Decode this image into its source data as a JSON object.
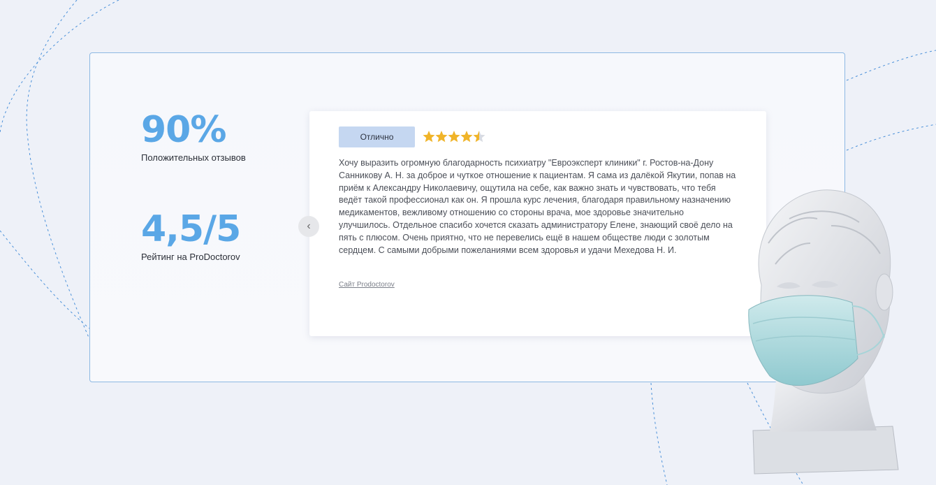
{
  "stats": [
    {
      "value": "90%",
      "label": "Положительных отзывов"
    },
    {
      "value": "4,5/5",
      "label": "Рейтинг на ProDoctorov"
    }
  ],
  "carousel": {
    "prev_icon": "‹"
  },
  "review": {
    "badge": "Отлично",
    "rating": 4.5,
    "rating_max": 5,
    "text": "Хочу выразить огромную благодарность психиатру \"Евроэксперт клиники\" г. Ростов-на-Дону Санникову А. Н. за доброе и чуткое отношение к пациентам. Я сама из далёкой Якутии, попав на приём к Александру Николаевичу, ощутила на себе, как важно знать и чувствовать, что тебя ведёт такой профессионал как он. Я прошла курс лечения, благодаря правильному назначению медикаментов, вежливому отношению со стороны врача, мое здоровье значительно улучшилось. Отдельное спасибо хочется сказать администратору Елене, знающий своё дело на пять с плюсом. Очень приятно, что не перевелись ещё в нашем обществе люди с золотым сердцем. С самыми добрыми пожеланиями всем здоровья и удачи Мехедова Н. И.",
    "source": "Сайт Prodoctorov"
  },
  "colors": {
    "accent": "#5aa7e6",
    "badge_bg": "#c5d7f1",
    "star": "#f0b429",
    "border": "#8db8e3",
    "background": "#eef1f8"
  },
  "icons": {
    "prev": "chevron-left-icon",
    "star": "star-icon"
  }
}
